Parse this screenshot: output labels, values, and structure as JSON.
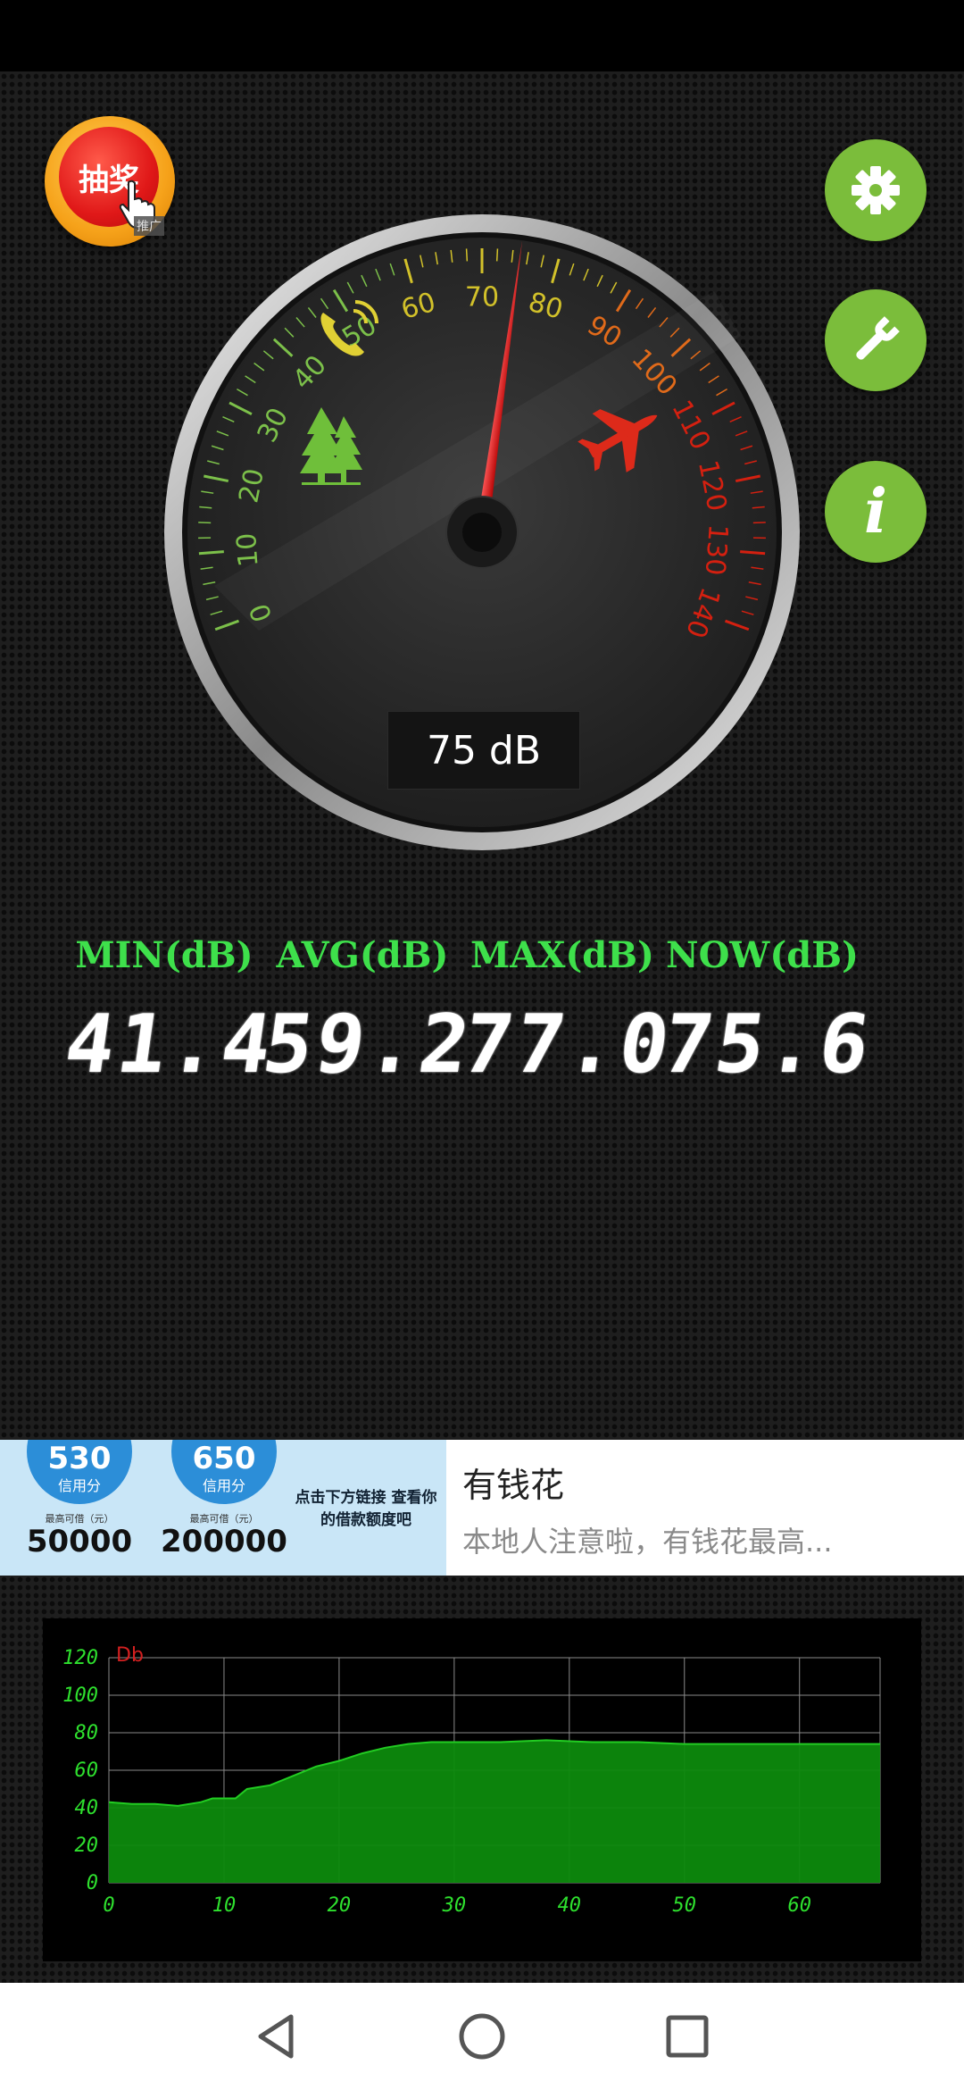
{
  "lottery_button": {
    "label": "抽奖",
    "tag": "推广"
  },
  "buttons": [
    "settings-icon",
    "wrench-icon",
    "info-icon"
  ],
  "gauge": {
    "ticks": [
      "0",
      "10",
      "20",
      "30",
      "40",
      "50",
      "60",
      "70",
      "80",
      "90",
      "100",
      "110",
      "120",
      "130",
      "140"
    ],
    "needle_value": 75,
    "readout": "75 dB",
    "icons": [
      "trees-icon",
      "phone-icon",
      "airplane-icon"
    ]
  },
  "stats": {
    "min_label": "MIN(dB)",
    "min_value": "41.4",
    "avg_label": "AVG(dB)",
    "avg_value": "59.2",
    "max_label": "MAX(dB)",
    "max_value": "77.0",
    "now_label": "NOW(dB)",
    "now_value": "75.6"
  },
  "ad": {
    "card1_score": "530",
    "card1_label": "信用分",
    "card1_amount": "50000",
    "card2_score": "650",
    "card2_label": "信用分",
    "card2_amount": "200000",
    "card_small": "最高可借（元）",
    "tagline": "点击下方链接 查看你的借款额度吧",
    "title": "有钱花",
    "description": "本地人注意啦，有钱花最高..."
  },
  "chart_data": {
    "type": "area",
    "ylabel": "Db",
    "yticks": [
      "0",
      "20",
      "40",
      "60",
      "80",
      "100",
      "120"
    ],
    "xticks": [
      "0",
      "10",
      "20",
      "30",
      "40",
      "50",
      "60"
    ],
    "ylim": [
      0,
      120
    ],
    "xlim": [
      0,
      67
    ],
    "grid": true,
    "series": [
      {
        "values": [
          [
            0,
            43
          ],
          [
            2,
            42
          ],
          [
            4,
            42
          ],
          [
            6,
            41
          ],
          [
            8,
            43
          ],
          [
            9,
            45
          ],
          [
            11,
            45
          ],
          [
            12,
            50
          ],
          [
            14,
            52
          ],
          [
            16,
            57
          ],
          [
            18,
            62
          ],
          [
            20,
            65
          ],
          [
            22,
            69
          ],
          [
            24,
            72
          ],
          [
            26,
            74
          ],
          [
            28,
            75
          ],
          [
            30,
            75
          ],
          [
            34,
            75
          ],
          [
            38,
            76
          ],
          [
            42,
            75
          ],
          [
            46,
            75
          ],
          [
            50,
            74
          ],
          [
            54,
            74
          ],
          [
            58,
            74
          ],
          [
            62,
            74
          ],
          [
            67,
            74
          ]
        ]
      }
    ],
    "color": "#0d8a0d"
  }
}
